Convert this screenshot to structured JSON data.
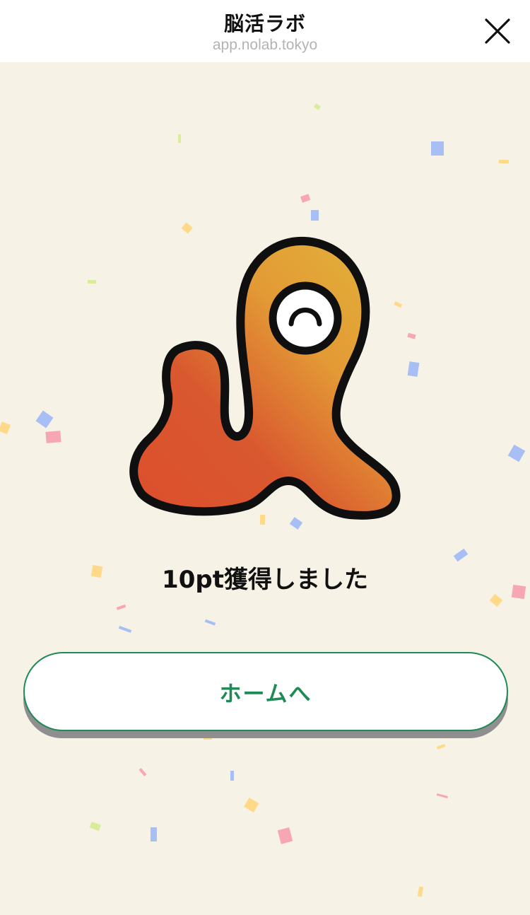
{
  "header": {
    "title": "脳活ラボ",
    "url": "app.nolab.tokyo"
  },
  "main": {
    "message": "10pt獲得しました",
    "home_button_label": "ホームへ"
  },
  "colors": {
    "background": "#f7f2e6",
    "accent_green": "#1e8a55",
    "mascot_orange": "#e0a832",
    "mascot_red": "#d9532e"
  }
}
